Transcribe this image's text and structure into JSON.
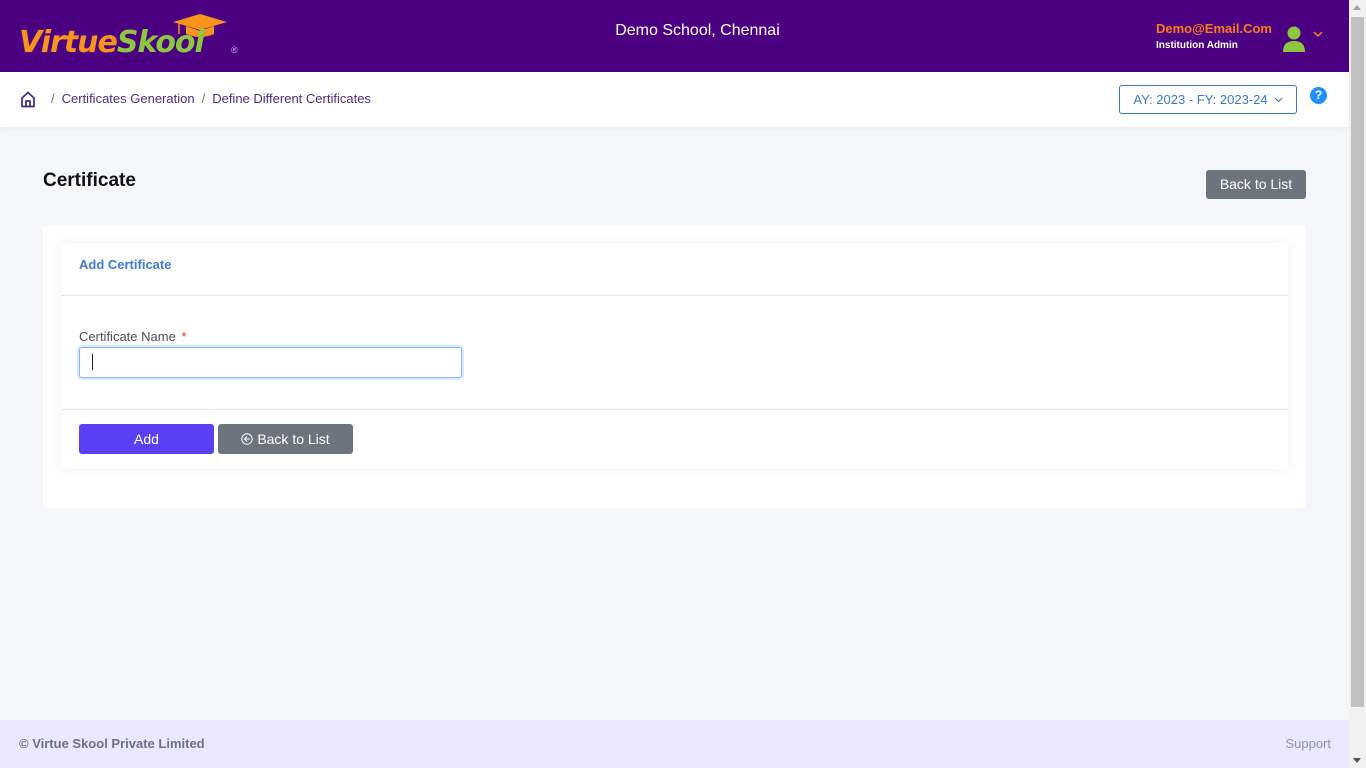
{
  "header": {
    "logo_part1": "Virtue",
    "logo_part2": "Skool",
    "logo_reg": "®",
    "school_name": "Demo School, Chennai",
    "user_email": "Demo@Email.Com",
    "user_role": "Institution Admin"
  },
  "breadcrumb": {
    "items": [
      "Certificates Generation",
      "Define Different Certificates"
    ],
    "separator": "/"
  },
  "year_selector": {
    "value": "AY: 2023 - FY: 2023-24"
  },
  "help": {
    "label": "?"
  },
  "page": {
    "title": "Certificate",
    "back_to_list_top": "Back to List"
  },
  "form": {
    "card_title": "Add Certificate",
    "certificate_name_label": "Certificate Name",
    "required_mark": "*",
    "certificate_name_value": "",
    "add_label": "Add",
    "back_label": "Back to List"
  },
  "footer": {
    "copyright": "© Virtue Skool Private Limited",
    "support": "Support"
  },
  "colors": {
    "header_bg": "#4b0082",
    "accent_orange": "#f7941d",
    "accent_green": "#8dc63f",
    "primary_button": "#5a3ff5",
    "secondary_button": "#6c757d",
    "link_blue": "#3f7ad6",
    "footer_bg": "#ebe7fd"
  }
}
